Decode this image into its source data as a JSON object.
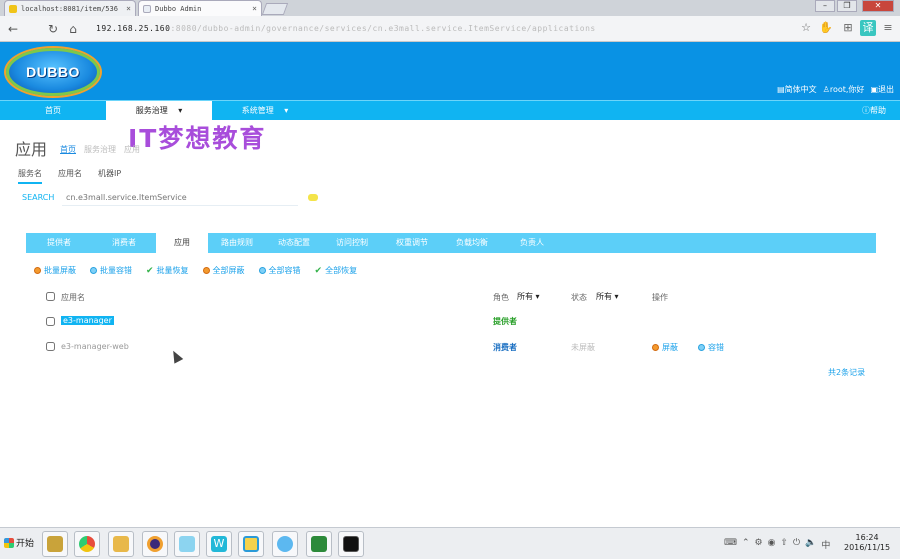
{
  "browser": {
    "tabs": [
      {
        "title": "localhost:8081/item/536",
        "active": false
      },
      {
        "title": "Dubbo Admin",
        "active": true
      }
    ],
    "url": "192.168.25.160",
    "url_rest": ":8080/dubbo-admin/governance/services/cn.e3mall.service.ItemService/applications"
  },
  "header": {
    "logo_text": "DUBBO",
    "links": {
      "lang": "简体中文",
      "user": "root,你好",
      "logout": "退出"
    }
  },
  "nav": {
    "items": [
      {
        "label": "首页",
        "active": false
      },
      {
        "label": "服务治理",
        "active": true,
        "caret": "▾"
      },
      {
        "label": "系统管理",
        "active": false,
        "caret": "▾"
      }
    ],
    "help": "帮助"
  },
  "watermark": "IT梦想教育",
  "page": {
    "title": "应用",
    "crumb_home": "首页",
    "crumb_2": "服务治理",
    "crumb_3": "应用"
  },
  "subtabs": [
    "服务名",
    "应用名",
    "机器IP"
  ],
  "search": {
    "label": "SEARCH",
    "placeholder": "cn.e3mall.service.ItemService"
  },
  "view_tabs": [
    "提供者",
    "消费者",
    "应用",
    "路由规则",
    "动态配置",
    "访问控制",
    "权重调节",
    "负载均衡",
    "负责人"
  ],
  "actions": [
    {
      "label": "批量屏蔽",
      "icon": "orange-dot"
    },
    {
      "label": "批量容错",
      "icon": "blue-dot"
    },
    {
      "label": "批量恢复",
      "icon": "check"
    },
    {
      "label": "全部屏蔽",
      "icon": "orange-dot"
    },
    {
      "label": "全部容错",
      "icon": "blue-dot"
    },
    {
      "label": "全部恢复",
      "icon": "check"
    }
  ],
  "table": {
    "headers": {
      "name": "应用名",
      "role": "角色",
      "role_filter": "所有",
      "status": "状态",
      "status_filter": "所有",
      "ops": "操作"
    },
    "rows": [
      {
        "name": "e3-manager",
        "role": "提供者",
        "status": "",
        "highlight": true
      },
      {
        "name": "e3-manager-web",
        "role": "消费者",
        "status": "未屏蔽",
        "actions": [
          "屏蔽",
          "容错"
        ]
      }
    ],
    "total": "共2条记录"
  },
  "taskbar": {
    "start": "开始",
    "time": "16:24",
    "date": "2016/11/15"
  }
}
